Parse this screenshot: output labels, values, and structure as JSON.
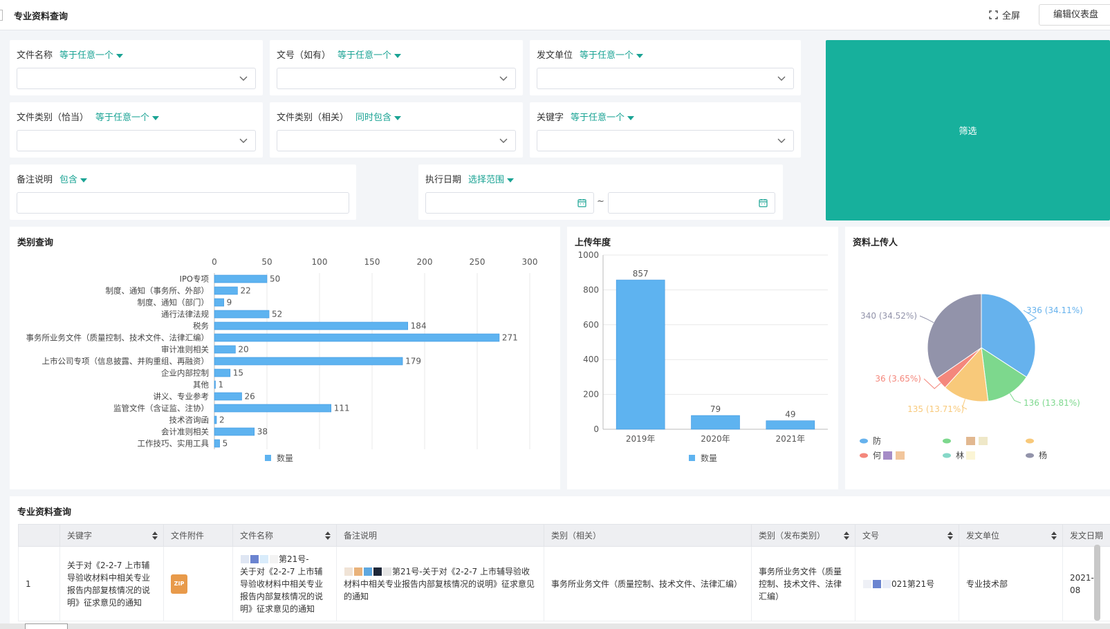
{
  "header": {
    "title": "专业资料查询",
    "fullscreen": "全屏",
    "edit": "编辑仪表盘"
  },
  "filters": {
    "file_name": {
      "label": "文件名称",
      "mode": "等于任意一个"
    },
    "doc_no": {
      "label": "文号（如有）",
      "mode": "等于任意一个"
    },
    "issuer": {
      "label": "发文单位",
      "mode": "等于任意一个"
    },
    "category_exact": {
      "label": "文件类别（恰当）",
      "mode": "等于任意一个"
    },
    "category_related": {
      "label": "文件类别（相关）",
      "mode": "同时包含"
    },
    "keyword": {
      "label": "关键字",
      "mode": "等于任意一个"
    },
    "remark": {
      "label": "备注说明",
      "mode": "包含"
    },
    "exec_date": {
      "label": "执行日期",
      "mode": "选择范围",
      "separator": "~"
    },
    "filter_button": "筛选"
  },
  "category_panel": {
    "title": "类别查询"
  },
  "year_panel": {
    "title": "上传年度"
  },
  "uploader_panel": {
    "title": "资料上传人"
  },
  "chart_data": [
    {
      "type": "bar",
      "orientation": "horizontal",
      "categories": [
        "IPO专项",
        "制度、通知（事务所、外部）",
        "制度、通知（部门）",
        "通行法律法规",
        "税务",
        "事务所业务文件（质量控制、技术文件、法律汇编）",
        "审计准则相关",
        "上市公司专项（信息披露、并购重组、再融资）",
        "企业内部控制",
        "其他",
        "讲义、专业参考",
        "监管文件（含证监、注协）",
        "技术咨询函",
        "会计准则相关",
        "工作技巧、实用工具"
      ],
      "series": [
        {
          "name": "数量",
          "values": [
            50,
            22,
            9,
            52,
            184,
            271,
            20,
            179,
            15,
            1,
            26,
            111,
            2,
            38,
            5
          ]
        }
      ],
      "xticks": [
        "0",
        "50",
        "100",
        "150",
        "200",
        "250",
        "300"
      ],
      "xlim": [
        0,
        300
      ],
      "color": "#5eb3f0",
      "legend": "bottom"
    },
    {
      "type": "bar",
      "categories": [
        "2019年",
        "2020年",
        "2021年"
      ],
      "series": [
        {
          "name": "数量",
          "values": [
            857,
            79,
            49
          ]
        }
      ],
      "yticks": [
        "0",
        "200",
        "400",
        "600",
        "800",
        "1000"
      ],
      "ylim": [
        0,
        1000
      ],
      "color": "#5eb3f0",
      "legend": "bottom"
    },
    {
      "type": "pie",
      "slices": [
        {
          "value": 336,
          "label": "336 (34.11%)",
          "color": "#66b2ed"
        },
        {
          "value": 136,
          "label": "136 (13.81%)",
          "color": "#7dd88d"
        },
        {
          "value": 135,
          "label": "135 (13.71%)",
          "color": "#f8c97a"
        },
        {
          "value": 36,
          "label": "36 (3.65%)",
          "color": "#f4877c"
        },
        {
          "value": 340,
          "label": "340 (34.52%)",
          "color": "#9293aa"
        }
      ],
      "legend": "bottom",
      "legend_text": [
        "防",
        "何",
        "林",
        "杨"
      ]
    }
  ],
  "table": {
    "title": "专业资料查询",
    "columns": [
      "关键字",
      "文件附件",
      "文件名称",
      "备注说明",
      "类别（相关）",
      "类别（发布类别）",
      "文号",
      "发文单位",
      "发文日期"
    ],
    "rows": [
      {
        "index": "1",
        "keyword": "关于对《2-2-7 上市辅导验收材料中相关专业报告内部复核情况的说明》征求意见的通知",
        "attachment": "ZIP",
        "file_name_a": "第21号-",
        "file_name_b": "关于对《2-2-7 上市辅导验收材料中相关专业报告内部复核情况的说明》征求意见的通知",
        "remark_a": "第21号-关于对《2-2-7 上市辅导验收",
        "remark_b": "材料中相关专业报告内部复核情况的说明》征求意见的通知",
        "cat_related": "事务所业务文件（质量控制、技术文件、法律汇编）",
        "cat_pub": "事务所业务文件（质量控制、技术文件、法律汇编）",
        "doc_no": "021第21号",
        "issuer": "专业技术部",
        "date": "2021-08"
      }
    ]
  }
}
